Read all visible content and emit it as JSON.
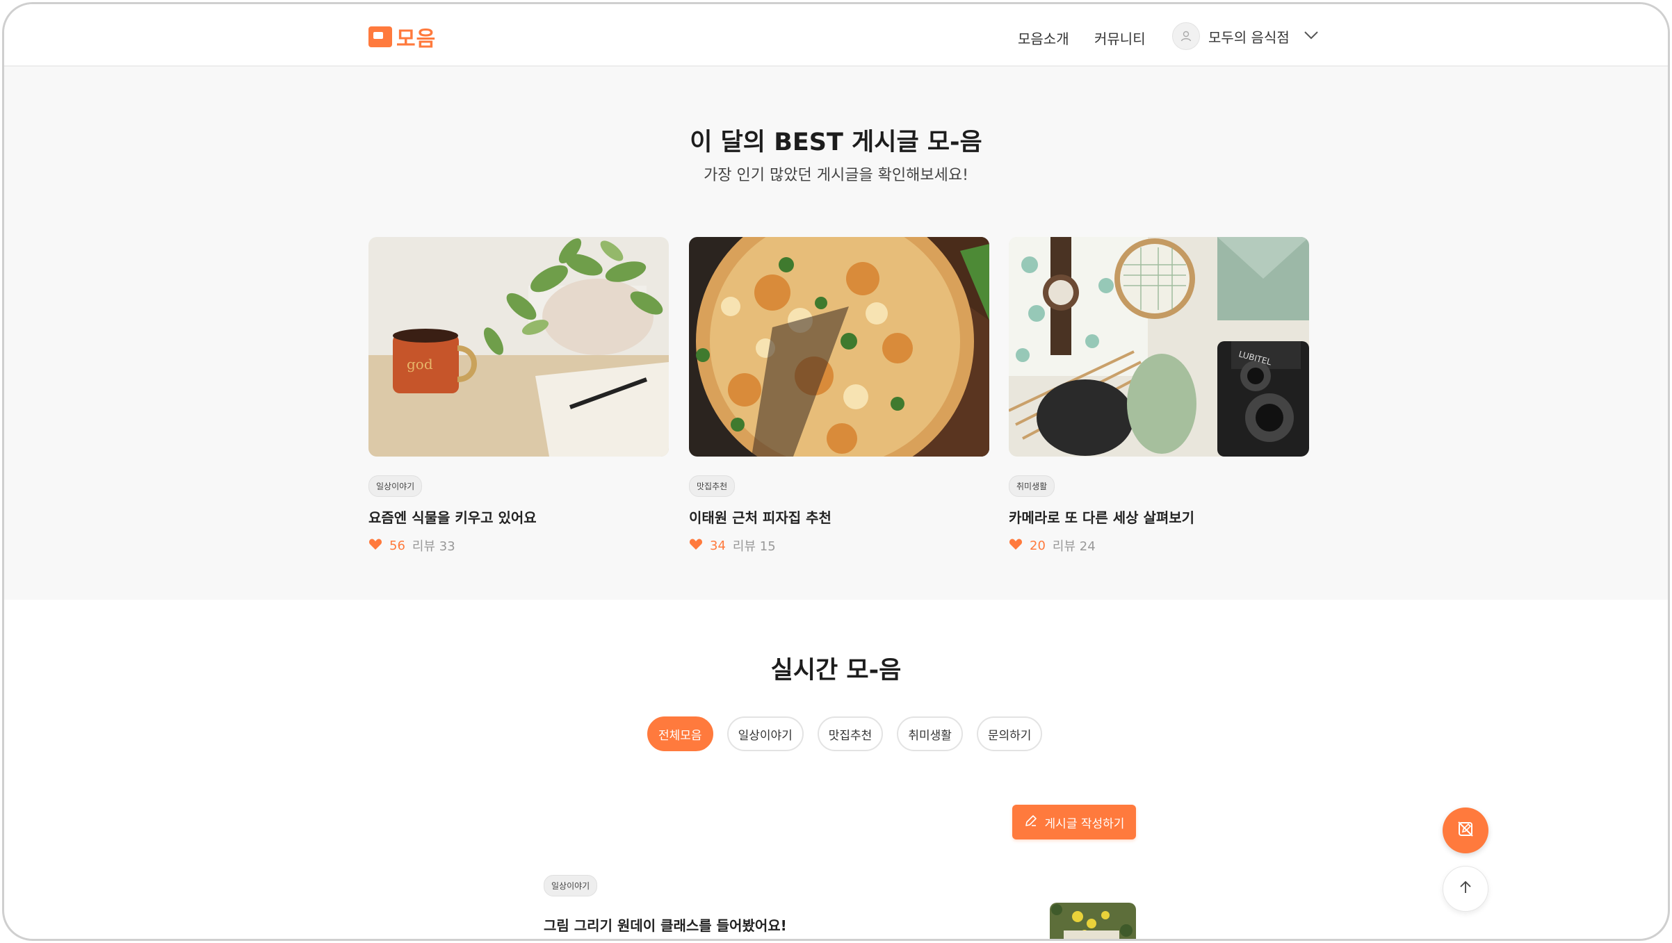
{
  "header": {
    "logo_text": "모음",
    "nav": {
      "intro": "모음소개",
      "community": "커뮤니티"
    },
    "user_name": "모두의 음식점"
  },
  "best": {
    "title": "이 달의 BEST 게시글 모-음",
    "subtitle": "가장 인기 많았던 게시글을 확인해보세요!",
    "cards": [
      {
        "tag": "일상이야기",
        "title": "요즘엔 식물을 키우고 있어요",
        "likes": "56",
        "reviews": "리뷰 33"
      },
      {
        "tag": "맛집추천",
        "title": "이태원 근처 피자집 추천",
        "likes": "34",
        "reviews": "리뷰 15"
      },
      {
        "tag": "취미생활",
        "title": "카메라로 또 다른 세상 살펴보기",
        "likes": "20",
        "reviews": "리뷰 24"
      }
    ]
  },
  "realtime": {
    "title": "실시간 모-음",
    "filters": [
      "전체모음",
      "일상이야기",
      "맛집추천",
      "취미생활",
      "문의하기"
    ],
    "active_filter": "전체모음",
    "write_button": "게시글 작성하기",
    "posts": [
      {
        "tag": "일상이야기",
        "title": "그림 그리기 원데이 클래스를 들어봤어요!"
      }
    ]
  },
  "colors": {
    "accent": "#ff7a3d",
    "section_bg": "#f8f8f8"
  },
  "icons": {
    "logo": "chat-bubble-logo-icon",
    "avatar": "user-icon",
    "dropdown": "chevron-down-icon",
    "like": "heart-icon",
    "write": "pencil-icon",
    "fab": "edit-off-icon",
    "scroll_top": "arrow-up-icon"
  }
}
